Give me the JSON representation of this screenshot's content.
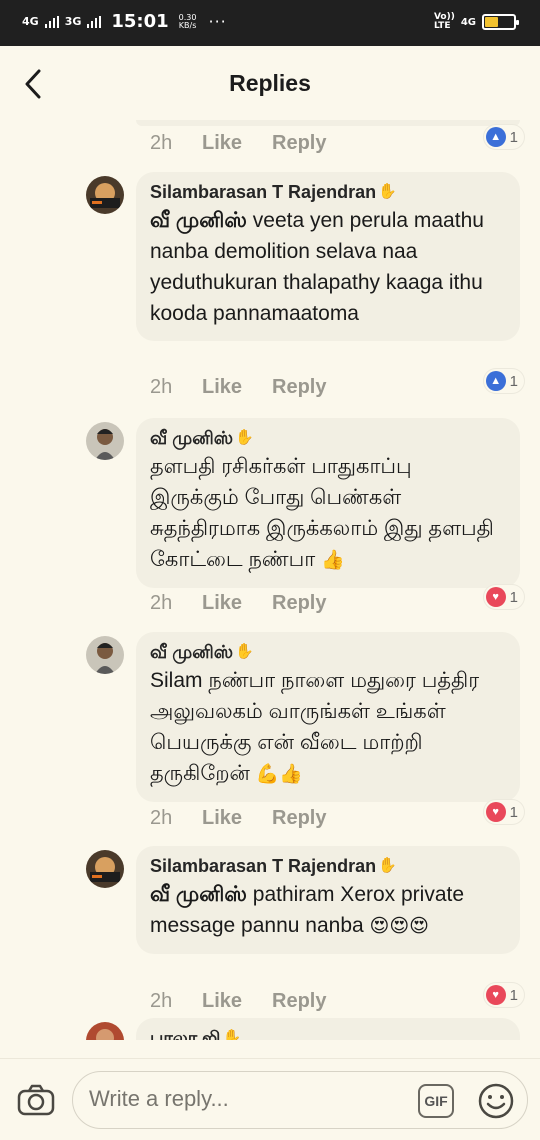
{
  "status_bar": {
    "signal1": "4G",
    "signal2": "3G",
    "time": "15:01",
    "speed_value": "0.30",
    "speed_unit": "KB/s",
    "dots": "···",
    "volte_top": "Vo))",
    "volte_bottom": "LTE",
    "network": "4G",
    "battery_color": "#f2c230"
  },
  "header": {
    "title": "Replies",
    "back_icon": "chevron-left-icon"
  },
  "top_meta": {
    "time": "2h",
    "like": "Like",
    "reply": "Reply",
    "reaction": "like",
    "count": "1"
  },
  "replies": [
    {
      "author": "Silambarasan T Rajendran",
      "mention": "வீ முனிஸ்",
      "text": " veeta yen perula maathu nanba demolition selava naa yeduthukuran thalapathy kaaga ithu kooda pannamaatoma",
      "time": "2h",
      "like": "Like",
      "reply": "Reply",
      "reaction": "like",
      "count": "1"
    },
    {
      "author": "வீ முனிஸ்",
      "text": "தளபதி ரசிகர்கள் பாதுகாப்பு இருக்கும் போது பெண்கள் சுதந்திரமாக இருக்கலாம் இது தளபதி கோட்டை நண்பா",
      "emoji": "👍",
      "time": "2h",
      "like": "Like",
      "reply": "Reply",
      "reaction": "heart",
      "count": "1"
    },
    {
      "author": "வீ முனிஸ்",
      "text": "Silam நண்பா நாளை மதுரை பத்திர அலுவலகம் வாருங்கள் உங்கள் பெயருக்கு என் வீடை மாற்றி தருகிறேன்",
      "emoji": "💪👍",
      "time": "2h",
      "like": "Like",
      "reply": "Reply",
      "reaction": "heart",
      "count": "1"
    },
    {
      "author": "Silambarasan T Rajendran",
      "mention": "வீ முனிஸ்",
      "text": " pathiram Xerox private message pannu nanba",
      "emoji": "😍😍😍",
      "time": "2h",
      "like": "Like",
      "reply": "Reply",
      "reaction": "heart",
      "count": "1"
    },
    {
      "author": "பாலா ஜி"
    }
  ],
  "composer": {
    "placeholder": "Write a reply...",
    "gif_label": "GIF",
    "camera_icon": "camera-icon",
    "emoji_icon": "smiley-icon"
  },
  "colors": {
    "background": "#fbf8ec",
    "bubble": "#f2efe3",
    "meta_text": "#9a988f",
    "like_blue": "#3b6fd8",
    "heart_red": "#e9485a"
  }
}
